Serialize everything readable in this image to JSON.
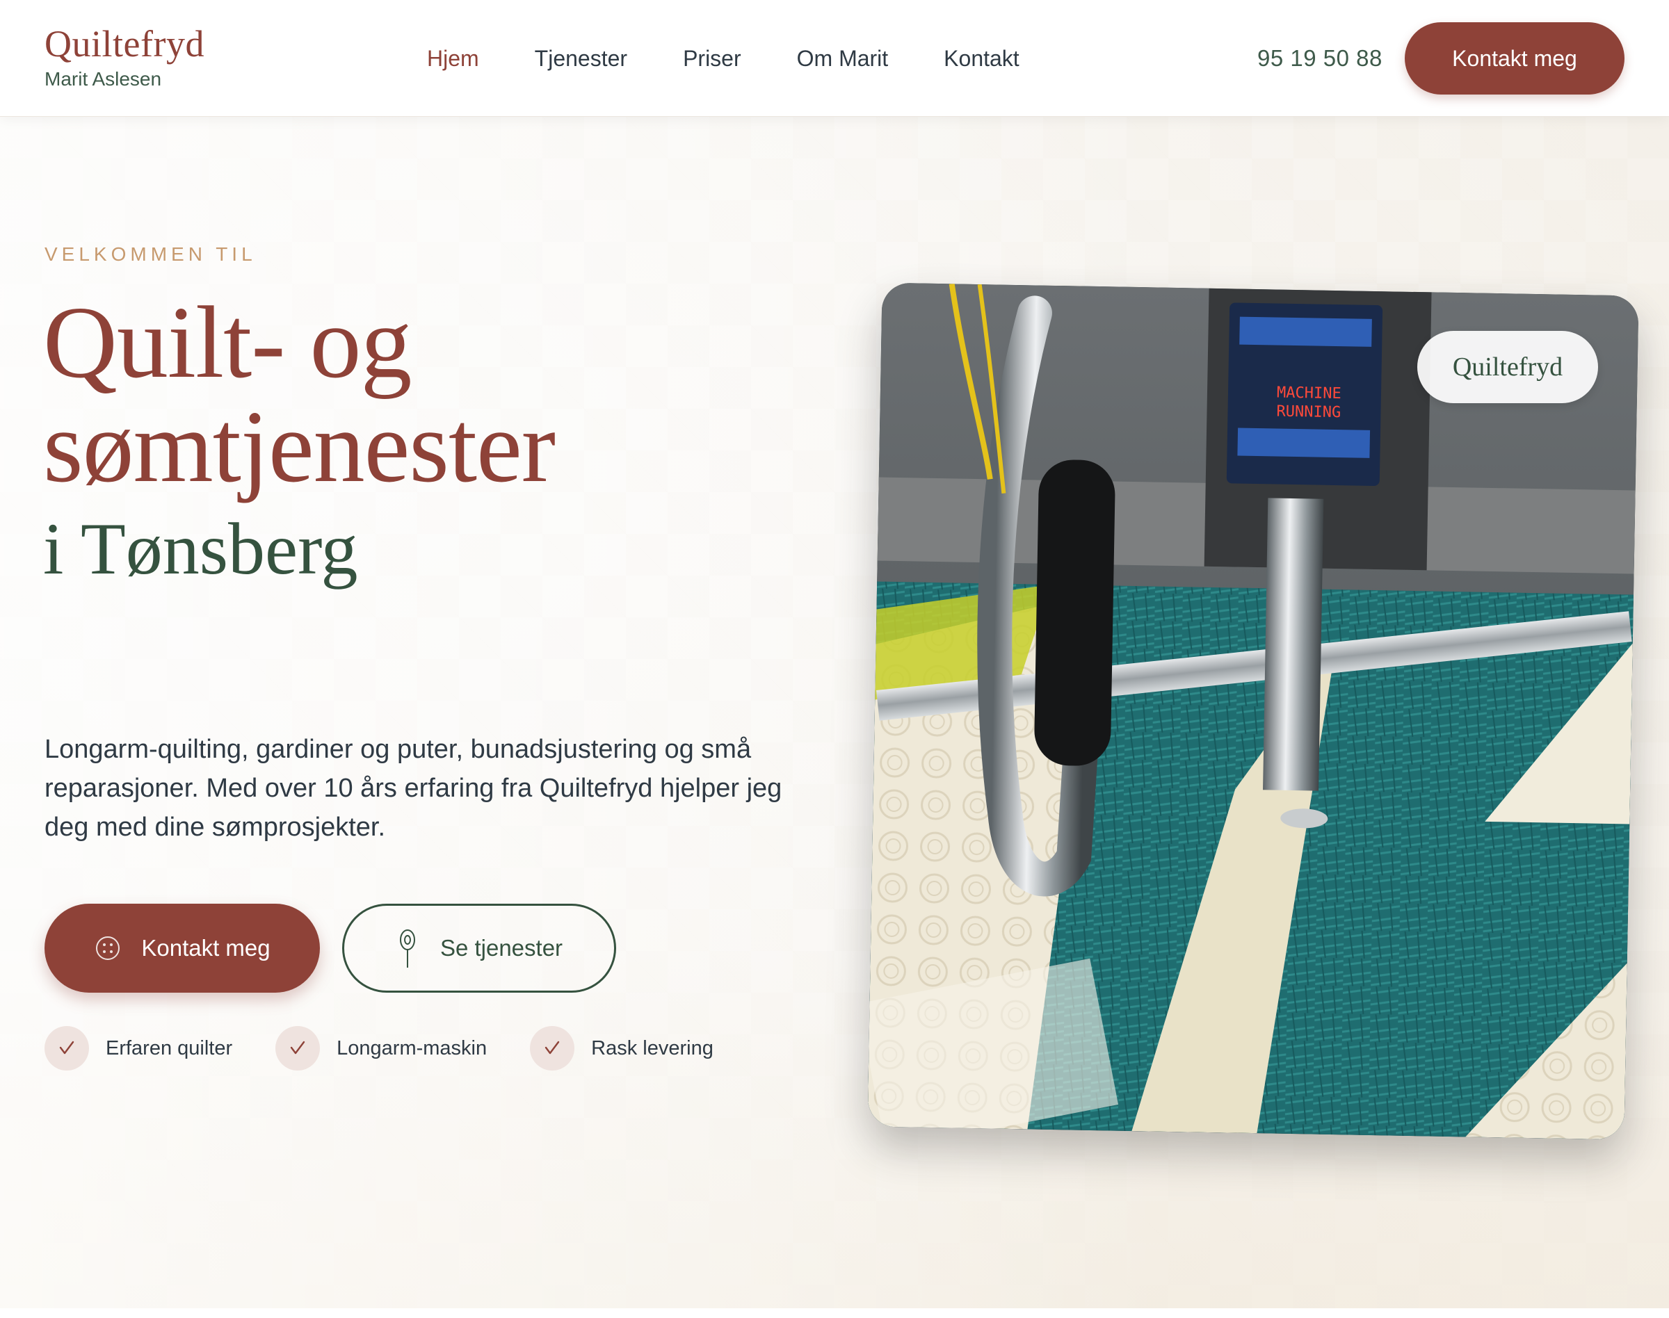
{
  "brand": {
    "name": "Quiltefryd",
    "owner": "Marit Aslesen"
  },
  "nav": {
    "items": [
      {
        "label": "Hjem",
        "active": true
      },
      {
        "label": "Tjenester",
        "active": false
      },
      {
        "label": "Priser",
        "active": false
      },
      {
        "label": "Om Marit",
        "active": false
      },
      {
        "label": "Kontakt",
        "active": false
      }
    ]
  },
  "header": {
    "phone": "95 19 50 88",
    "cta_label": "Kontakt meg"
  },
  "hero": {
    "eyebrow": "VELKOMMEN TIL",
    "headline_line1": "Quilt- og",
    "headline_line2": "sømtjenester",
    "headline_sub": "i Tønsberg",
    "lead": "Longarm-quilting, gardiner og puter, bunadsjustering og små reparasjoner. Med over 10 års erfaring fra Quiltefryd hjelper jeg deg med dine sømprosjekter.",
    "primary_button": {
      "label": "Kontakt meg",
      "icon": "button-icon"
    },
    "secondary_button": {
      "label": "Se tjenester",
      "icon": "needle-icon"
    },
    "features": [
      {
        "label": "Erfaren quilter",
        "icon": "check-icon"
      },
      {
        "label": "Longarm-maskin",
        "icon": "check-icon"
      },
      {
        "label": "Rask levering",
        "icon": "check-icon"
      }
    ],
    "photo_badge": "Quiltefryd",
    "photo_screen_text": "MACHINE RUNNING"
  },
  "colors": {
    "brand_red": "#8e4238",
    "brand_green": "#35523f",
    "eyebrow_gold": "#c79a6e",
    "text_dark": "#2f3a44",
    "quilt_teal": "#1f6d70"
  }
}
